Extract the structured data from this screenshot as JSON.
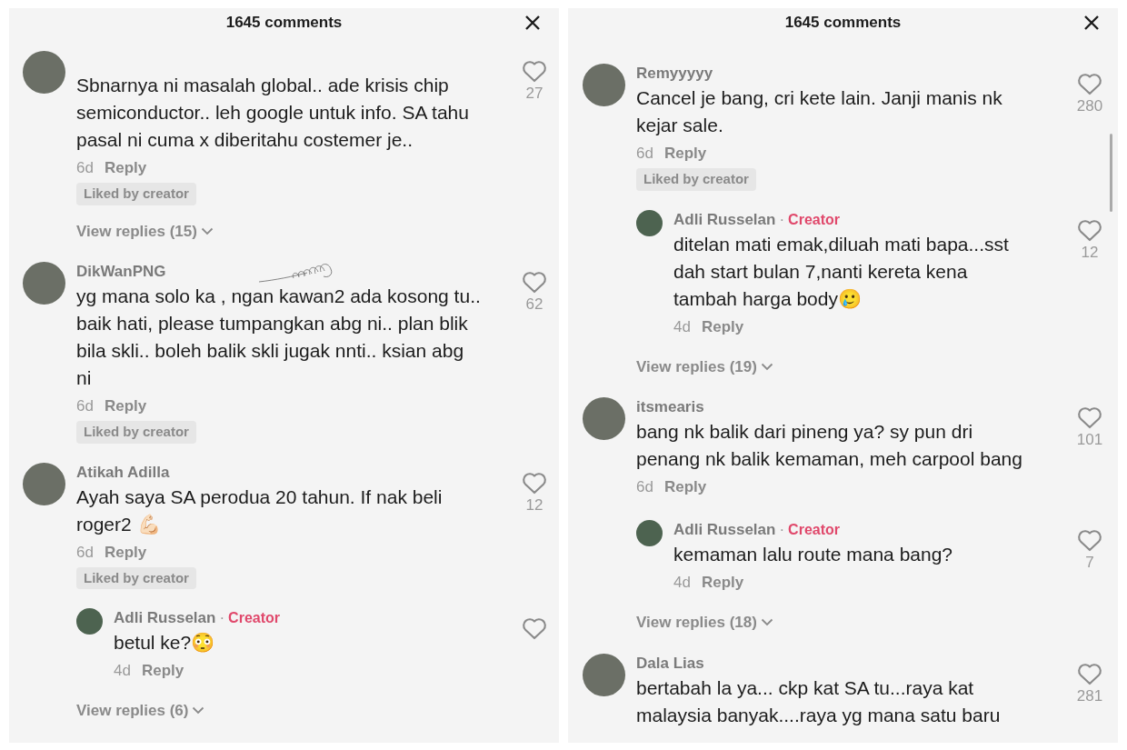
{
  "panels": [
    {
      "title": "1645 comments",
      "comments": [
        {
          "text": "Sbnarnya ni masalah global.. ade krisis chip semiconductor.. leh google untuk info. SA tahu pasal ni cuma x diberitahu costemer je..",
          "time": "6d",
          "reply": "Reply",
          "liked_label": "Liked by creator",
          "likes": "27",
          "replies_label": "View replies (15)"
        },
        {
          "user": "DikWanPNG",
          "scribble": true,
          "text": "yg mana solo ka , ngan kawan2 ada kosong tu.. baik hati, please tumpangkan abg ni.. plan blik bila skli.. boleh balik skli jugak nnti.. ksian abg ni",
          "time": "6d",
          "reply": "Reply",
          "liked_label": "Liked by creator",
          "likes": "62"
        },
        {
          "user": "Atikah Adilla",
          "text": "Ayah saya SA perodua 20 tahun. If nak beli roger2 💪🏻",
          "time": "6d",
          "reply": "Reply",
          "liked_label": "Liked by creator",
          "likes": "12",
          "children": [
            {
              "user": "Adli Russelan",
              "badge": {
                "separator": "·",
                "label": "Creator"
              },
              "text": "betul ke?😳",
              "time": "4d",
              "reply": "Reply"
            }
          ],
          "replies_label": "View replies (6)"
        }
      ]
    },
    {
      "title": "1645 comments",
      "comments": [
        {
          "user": "Remyyyyy",
          "text": "Cancel je bang, cri kete lain. Janji manis nk kejar sale.",
          "time": "6d",
          "reply": "Reply",
          "liked_label": "Liked by creator",
          "likes": "280",
          "children": [
            {
              "user": "Adli Russelan",
              "badge": {
                "separator": "·",
                "label": "Creator"
              },
              "text": "ditelan mati emak,diluah mati bapa...sst dah start bulan 7,nanti kereta kena tambah harga body🥲",
              "time": "4d",
              "reply": "Reply",
              "likes": "12"
            }
          ],
          "replies_label": "View replies (19)"
        },
        {
          "user": "itsmearis",
          "text": "bang nk balik dari pineng ya? sy pun dri penang nk balik kemaman, meh carpool bang",
          "time": "6d",
          "reply": "Reply",
          "likes": "101",
          "children": [
            {
              "user": "Adli Russelan",
              "badge": {
                "separator": "·",
                "label": "Creator"
              },
              "text": "kemaman lalu route mana bang?",
              "time": "4d",
              "reply": "Reply",
              "likes": "7"
            }
          ],
          "replies_label": "View replies (18)"
        },
        {
          "user": "Dala Lias",
          "text": "bertabah la ya... ckp kat SA tu...raya kat malaysia banyak....raya yg mana satu baru",
          "likes": "281"
        }
      ]
    }
  ]
}
